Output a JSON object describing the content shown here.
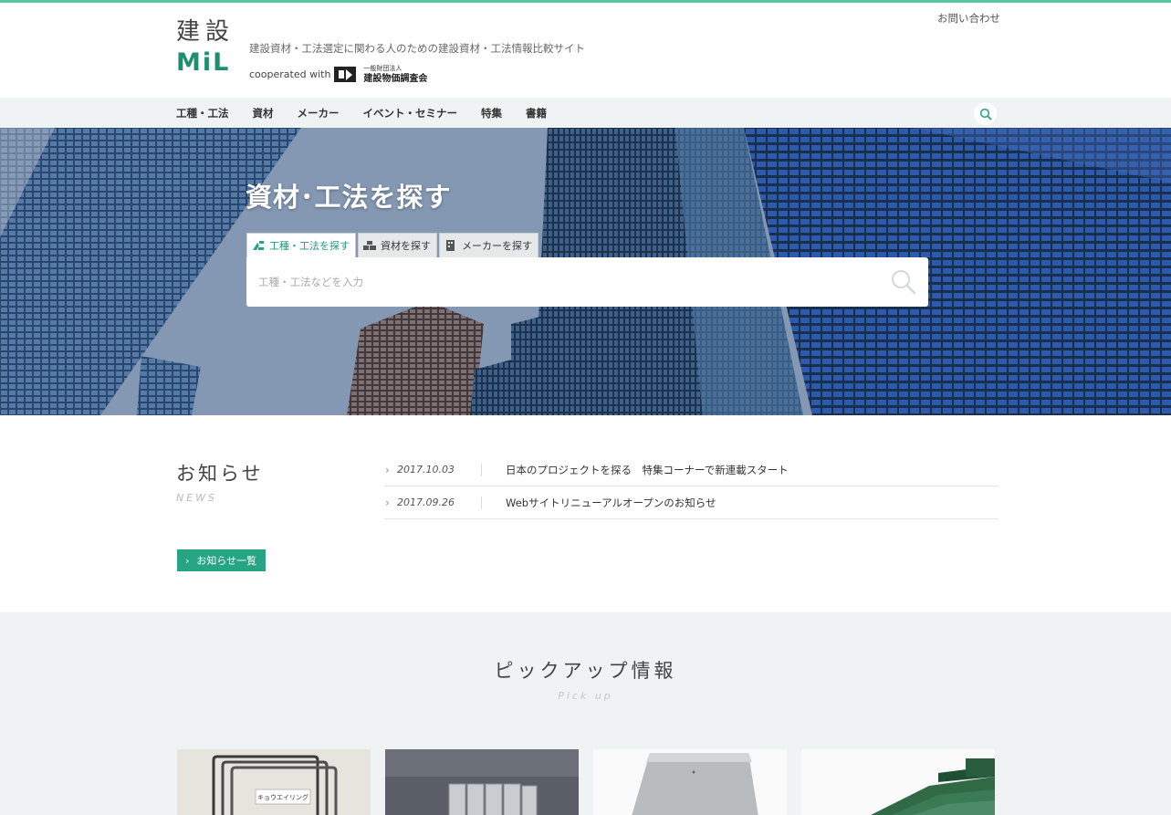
{
  "header": {
    "logo_kanji": "建設",
    "logo_mil": "MiL",
    "tagline": "建設資材・工法選定に関わる人のための建設資材・工法情報比較サイト",
    "cooperated_label": "cooperated with",
    "org_small": "一般財団法人",
    "org_name": "建設物価調査会",
    "contact_link": "お問い合わせ"
  },
  "nav": {
    "items": [
      "工種・工法",
      "資材",
      "メーカー",
      "イベント・セミナー",
      "特集",
      "書籍"
    ]
  },
  "hero": {
    "title": "資材･工法を探す",
    "tabs": [
      {
        "label": "工種・工法を探す",
        "icon": "construction-icon",
        "active": true
      },
      {
        "label": "資材を探す",
        "icon": "materials-icon",
        "active": false
      },
      {
        "label": "メーカーを探す",
        "icon": "building-icon",
        "active": false
      }
    ],
    "search_placeholder": "工種・工法などを入力"
  },
  "news": {
    "title": "お知らせ",
    "subtitle": "NEWS",
    "items": [
      {
        "date": "2017.10.03",
        "text": "日本のプロジェクトを探る　特集コーナーで新連載スタート"
      },
      {
        "date": "2017.09.26",
        "text": "Webサイトリニューアルオープンのお知らせ"
      }
    ],
    "more_label": "お知らせ一覧"
  },
  "pickup": {
    "title": "ピックアップ情報",
    "subtitle": "Pick up",
    "card_label_1": "キョウエイリング"
  },
  "colors": {
    "accent": "#26a484",
    "topline": "#57c7a5",
    "nav_bg": "#f0f3f3"
  }
}
